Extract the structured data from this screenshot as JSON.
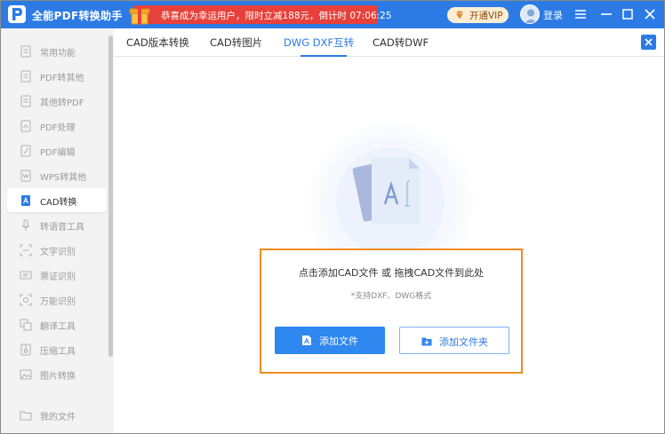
{
  "app": {
    "title": "全能PDF转换助手"
  },
  "promo": {
    "text": "恭喜成为幸运用户，限时立减188元，倒计时 07:06:25"
  },
  "header": {
    "vip_label": "开通VIP",
    "login_label": "登录"
  },
  "sidebar": {
    "items": [
      {
        "label": "常用功能",
        "icon": "star-icon"
      },
      {
        "label": "PDF转其他",
        "icon": "pdf-icon"
      },
      {
        "label": "其他转PDF",
        "icon": "pdf-icon"
      },
      {
        "label": "PDF处理",
        "icon": "pdf-process-icon"
      },
      {
        "label": "PDF编辑",
        "icon": "pdf-edit-icon"
      },
      {
        "label": "WPS转其他",
        "icon": "wps-icon"
      },
      {
        "label": "CAD转换",
        "icon": "cad-icon",
        "active": true
      },
      {
        "label": "转语音工具",
        "icon": "voice-icon"
      },
      {
        "label": "文字识别",
        "icon": "ocr-icon"
      },
      {
        "label": "票证识别",
        "icon": "ticket-icon"
      },
      {
        "label": "万能识别",
        "icon": "scan-icon"
      },
      {
        "label": "翻译工具",
        "icon": "translate-icon"
      },
      {
        "label": "压缩工具",
        "icon": "compress-icon"
      },
      {
        "label": "图片转换",
        "icon": "image-icon"
      },
      {
        "label": "我的文件",
        "icon": "folder-icon"
      }
    ]
  },
  "tabs": [
    {
      "label": "CAD版本转换"
    },
    {
      "label": "CAD转图片"
    },
    {
      "label": "DWG DXF互转",
      "active": true
    },
    {
      "label": "CAD转DWF"
    }
  ],
  "dropzone": {
    "title": "点击添加CAD文件 或 拖拽CAD文件到此处",
    "subtitle": "*支持DXF、DWG格式",
    "add_file_label": "添加文件",
    "add_folder_label": "添加文件夹"
  },
  "colors": {
    "accent": "#2c7be5",
    "promo": "#e8403a",
    "highlight_border": "#f08c1e"
  }
}
